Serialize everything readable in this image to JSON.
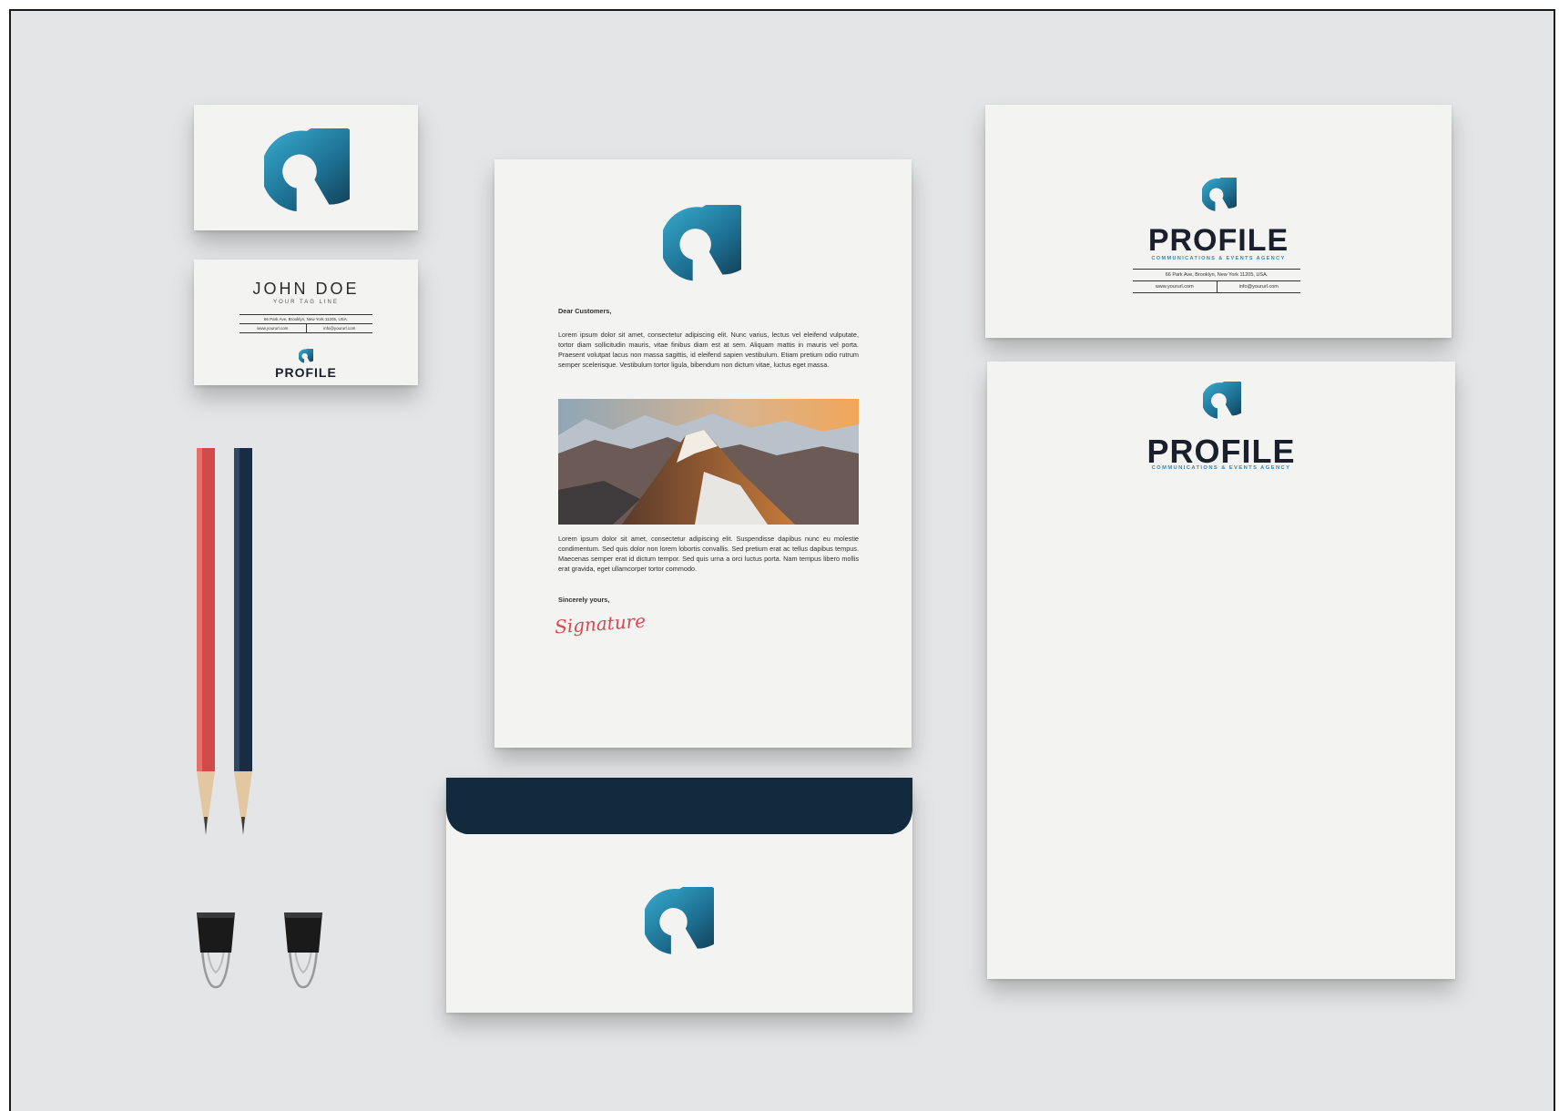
{
  "business_card": {
    "name": "JOHN DOE",
    "tagline": "YOUR TAG LINE",
    "address": "66 Park Ave, Brooklyn, New York 11205, USA.",
    "website": "www.yoururl.com",
    "email": "info@yoururl.com",
    "brand": "PROFILE"
  },
  "letterhead": {
    "greeting": "Dear Customers,",
    "paragraph_1": "Lorem ipsum dolor sit amet, consectetur adipiscing elit. Nunc varius, lectus vel eleifend vulputate, tortor diam sollicitudin mauris, vitae finibus diam est at sem. Aliquam mattis in mauris vel porta. Praesent volutpat lacus non massa sagittis, id eleifend sapien vestibulum. Etiam pretium odio rutrum semper scelerisque. Vestibulum tortor ligula, bibendum non dictum vitae, luctus eget massa.",
    "paragraph_2": "Lorem ipsum dolor sit amet, consectetur adipiscing elit. Suspendisse dapibus nunc eu molestie condimentum. Sed quis dolor non lorem lobortis convallis. Sed pretium erat ac tellus dapibus tempus. Maecenas semper erat id dictum tempor. Sed quis urna a orci luctus porta. Nam tempus libero mollis erat gravida, eget ullamcorper tortor commodo.",
    "closing": "Sincerely yours,",
    "signature": "Signature"
  },
  "compliment_slip": {
    "brand": "PROFILE",
    "subtitle": "COMMUNICATIONS & EVENTS AGENCY",
    "address": "66 Park Ave, Brooklyn, New York 11205, USA.",
    "website": "www.yoururl.com",
    "email": "info@yoururl.com"
  },
  "folder": {
    "brand": "PROFILE",
    "subtitle": "COMMUNICATIONS & EVENTS AGENCY"
  },
  "colors": {
    "background": "#e4e5e6",
    "paper": "#f3f3f2",
    "brand_navy": "#13293d",
    "brand_teal": "#2a8ab8",
    "pencil_red": "#d24a47",
    "pencil_navy": "#1a2c44",
    "signature": "#d9474f"
  }
}
